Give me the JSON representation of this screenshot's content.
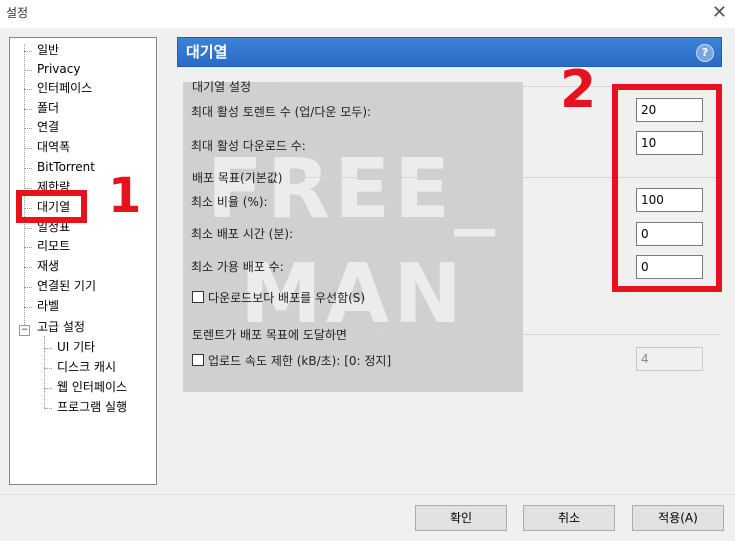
{
  "window": {
    "title": "설정"
  },
  "tree": {
    "items": [
      {
        "label": "일반"
      },
      {
        "label": "Privacy"
      },
      {
        "label": "인터페이스"
      },
      {
        "label": "폴더"
      },
      {
        "label": "연결"
      },
      {
        "label": "대역폭"
      },
      {
        "label": "BitTorrent"
      },
      {
        "label": "제한량"
      },
      {
        "label": "대기열"
      },
      {
        "label": "일정표"
      },
      {
        "label": "리모트"
      },
      {
        "label": "재생"
      },
      {
        "label": "연결된 기기"
      },
      {
        "label": "라벨"
      },
      {
        "label": "고급 설정"
      }
    ],
    "children": [
      {
        "label": "UI 기타"
      },
      {
        "label": "디스크 캐시"
      },
      {
        "label": "웹 인터페이스"
      },
      {
        "label": "프로그램 실행"
      }
    ],
    "expander": "−"
  },
  "panel": {
    "title": "대기열",
    "help": "?"
  },
  "queue_settings": {
    "title": "대기열 설정",
    "max_active_torrents_label": "최대 활성 토렌트 수 (업/다운 모두):",
    "max_active_torrents_value": "20",
    "max_active_downloads_label": "최대 활성 다운로드 수:",
    "max_active_downloads_value": "10"
  },
  "seeding_goals": {
    "title": "배포 목표(기본값)",
    "min_ratio_label": "최소 비율 (%):",
    "min_ratio_value": "100",
    "min_seed_time_label": "최소 배포 시간 (분):",
    "min_seed_time_value": "0",
    "min_available_seeds_label": "최소 가용 배포 수:",
    "min_available_seeds_value": "0",
    "prioritize_seeding_label": "다운로드보다 배포를 우선함(S)"
  },
  "when_goal_reached": {
    "title": "토렌트가 배포 목표에 도달하면",
    "limit_upload_label": "업로드 속도 제한 (kB/초): [0: 정지]",
    "limit_upload_value": "4"
  },
  "buttons": {
    "ok": "확인",
    "cancel": "취소",
    "apply": "적용(A)"
  },
  "watermark": {
    "line1": "FREE_",
    "line2": "MAN"
  },
  "annotations": {
    "marker1": "1",
    "marker2": "2"
  },
  "colors": {
    "accent": "#2a6cc4",
    "marker": "#e8121e"
  }
}
